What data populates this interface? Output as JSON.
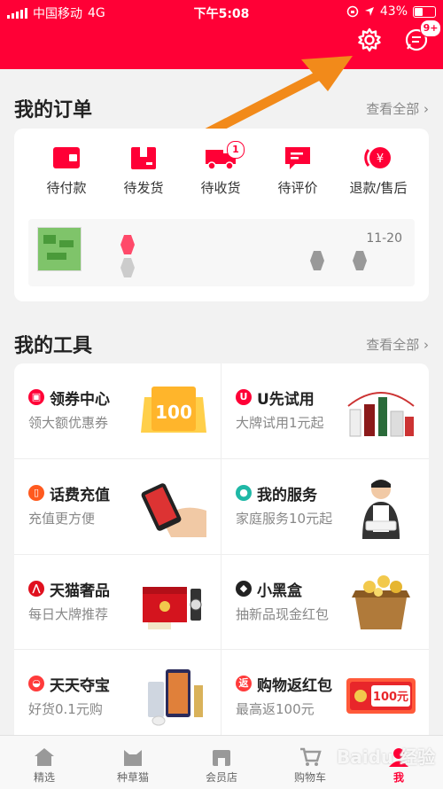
{
  "status": {
    "carrier": "中国移动",
    "network": "4G",
    "time": "下午5:08",
    "battery": "43%"
  },
  "header": {
    "message_badge": "9+"
  },
  "orders": {
    "title": "我的订单",
    "see_all": "查看全部 ›",
    "items": [
      {
        "label": "待付款",
        "icon": "wallet-icon"
      },
      {
        "label": "待发货",
        "icon": "box-icon"
      },
      {
        "label": "待收货",
        "icon": "truck-icon",
        "badge": "1"
      },
      {
        "label": "待评价",
        "icon": "comment-icon"
      },
      {
        "label": "退款/售后",
        "icon": "refund-icon"
      }
    ],
    "latest_date": "11-20"
  },
  "tools": {
    "title": "我的工具",
    "see_all": "查看全部 ›",
    "items": [
      {
        "title": "领券中心",
        "subtitle": "领大额优惠券",
        "icon": "coupon-icon",
        "color": "#ff0036",
        "pic_text": "100"
      },
      {
        "title": "U先试用",
        "subtitle": "大牌试用1元起",
        "icon": "u-icon",
        "color": "#ff0036",
        "glyph": "U"
      },
      {
        "title": "话费充值",
        "subtitle": "充值更方便",
        "icon": "phone-icon",
        "color": "#ff5a1f"
      },
      {
        "title": "我的服务",
        "subtitle": "家庭服务10元起",
        "icon": "service-icon",
        "color": "#1fb8a6"
      },
      {
        "title": "天猫奢品",
        "subtitle": "每日大牌推荐",
        "icon": "luxury-icon",
        "color": "#e0101e",
        "glyph": "⋀"
      },
      {
        "title": "小黑盒",
        "subtitle": "抽新品现金红包",
        "icon": "blackbox-icon",
        "color": "#222222"
      },
      {
        "title": "天天夺宝",
        "subtitle": "好货0.1元购",
        "icon": "treasure-icon",
        "color": "#ff3b3b"
      },
      {
        "title": "购物返红包",
        "subtitle": "最高返100元",
        "icon": "redpacket-icon",
        "color": "#ff3b3b",
        "glyph": "返",
        "pic_text": "100元"
      }
    ]
  },
  "tabbar": {
    "items": [
      {
        "label": "精选"
      },
      {
        "label": "种草猫"
      },
      {
        "label": "会员店"
      },
      {
        "label": "购物车"
      },
      {
        "label": "我"
      }
    ]
  },
  "watermark": "Baidu 经验",
  "colors": {
    "brand": "#ff0036",
    "annotation_arrow": "#f28a1a"
  }
}
